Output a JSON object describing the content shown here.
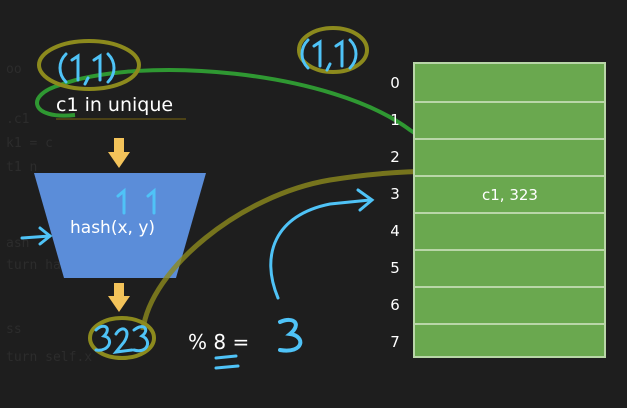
{
  "diagram": {
    "lookup_label": "c1 in unique",
    "hash_function": "hash(x, y)",
    "modulo_expression": "% 8 =",
    "table_row_numbers": [
      "0",
      "1",
      "2",
      "3",
      "4",
      "5",
      "6",
      "7"
    ],
    "table_cell_entry": "c1, 323"
  },
  "colors": {
    "background": "#1e1e1e",
    "hash_box": "#5b8dd9",
    "table": "#6aa84f",
    "arrow_yellow": "#f3c35a",
    "annotation_cyan": "#4fc3f7",
    "annotation_olive": "#8c8a1d",
    "annotation_green": "#36c23a"
  }
}
